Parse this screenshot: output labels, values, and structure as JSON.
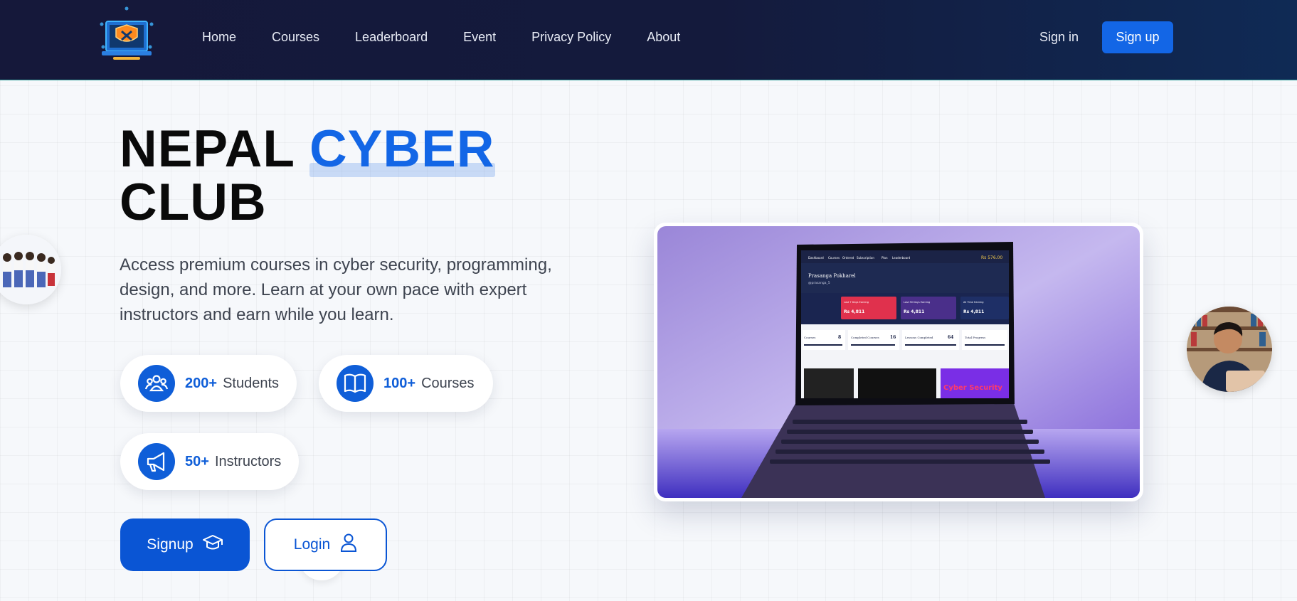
{
  "nav": {
    "links": [
      "Home",
      "Courses",
      "Leaderboard",
      "Event",
      "Privacy Policy",
      "About"
    ],
    "signin": "Sign in",
    "signup": "Sign up"
  },
  "hero": {
    "title_part1": "NEPAL",
    "title_accent": "CYBER",
    "title_part2": "CLUB",
    "subtitle": "Access premium courses in cyber security, programming, design, and more. Learn at your own pace with expert instructors and earn while you learn.",
    "stats": [
      {
        "number": "200+",
        "label": "Students",
        "icon": "users-icon"
      },
      {
        "number": "100+",
        "label": "Courses",
        "icon": "book-icon"
      },
      {
        "number": "50+",
        "label": "Instructors",
        "icon": "megaphone-icon"
      }
    ],
    "signup_button": "Signup",
    "login_button": "Login"
  },
  "laptop_screen": {
    "nav": [
      "Dashboard",
      "Courses",
      "Ordered",
      "Subscription",
      "Plan",
      "Leaderboard"
    ],
    "balance": "Rs 576.00",
    "user_name": "Prasanga Pokharel",
    "user_handle": "@prasanga_5",
    "cards": [
      {
        "label": "Last 7 Days Earning",
        "value": "Rs 4,811"
      },
      {
        "label": "Last 30 Days Earning",
        "value": "Rs 4,811"
      },
      {
        "label": "All Time Earning",
        "value": "Rs 4,811"
      }
    ],
    "stats": [
      {
        "label": "Courses",
        "value": "8"
      },
      {
        "label": "Completed Courses",
        "value": "16"
      },
      {
        "label": "Lessons Completed",
        "value": "64"
      },
      {
        "label": "Total Progress",
        "value": ""
      }
    ],
    "banner": "Cyber Security"
  },
  "colors": {
    "accent": "#1366e6",
    "navbar": "#15183a",
    "button": "#0a55d4"
  }
}
